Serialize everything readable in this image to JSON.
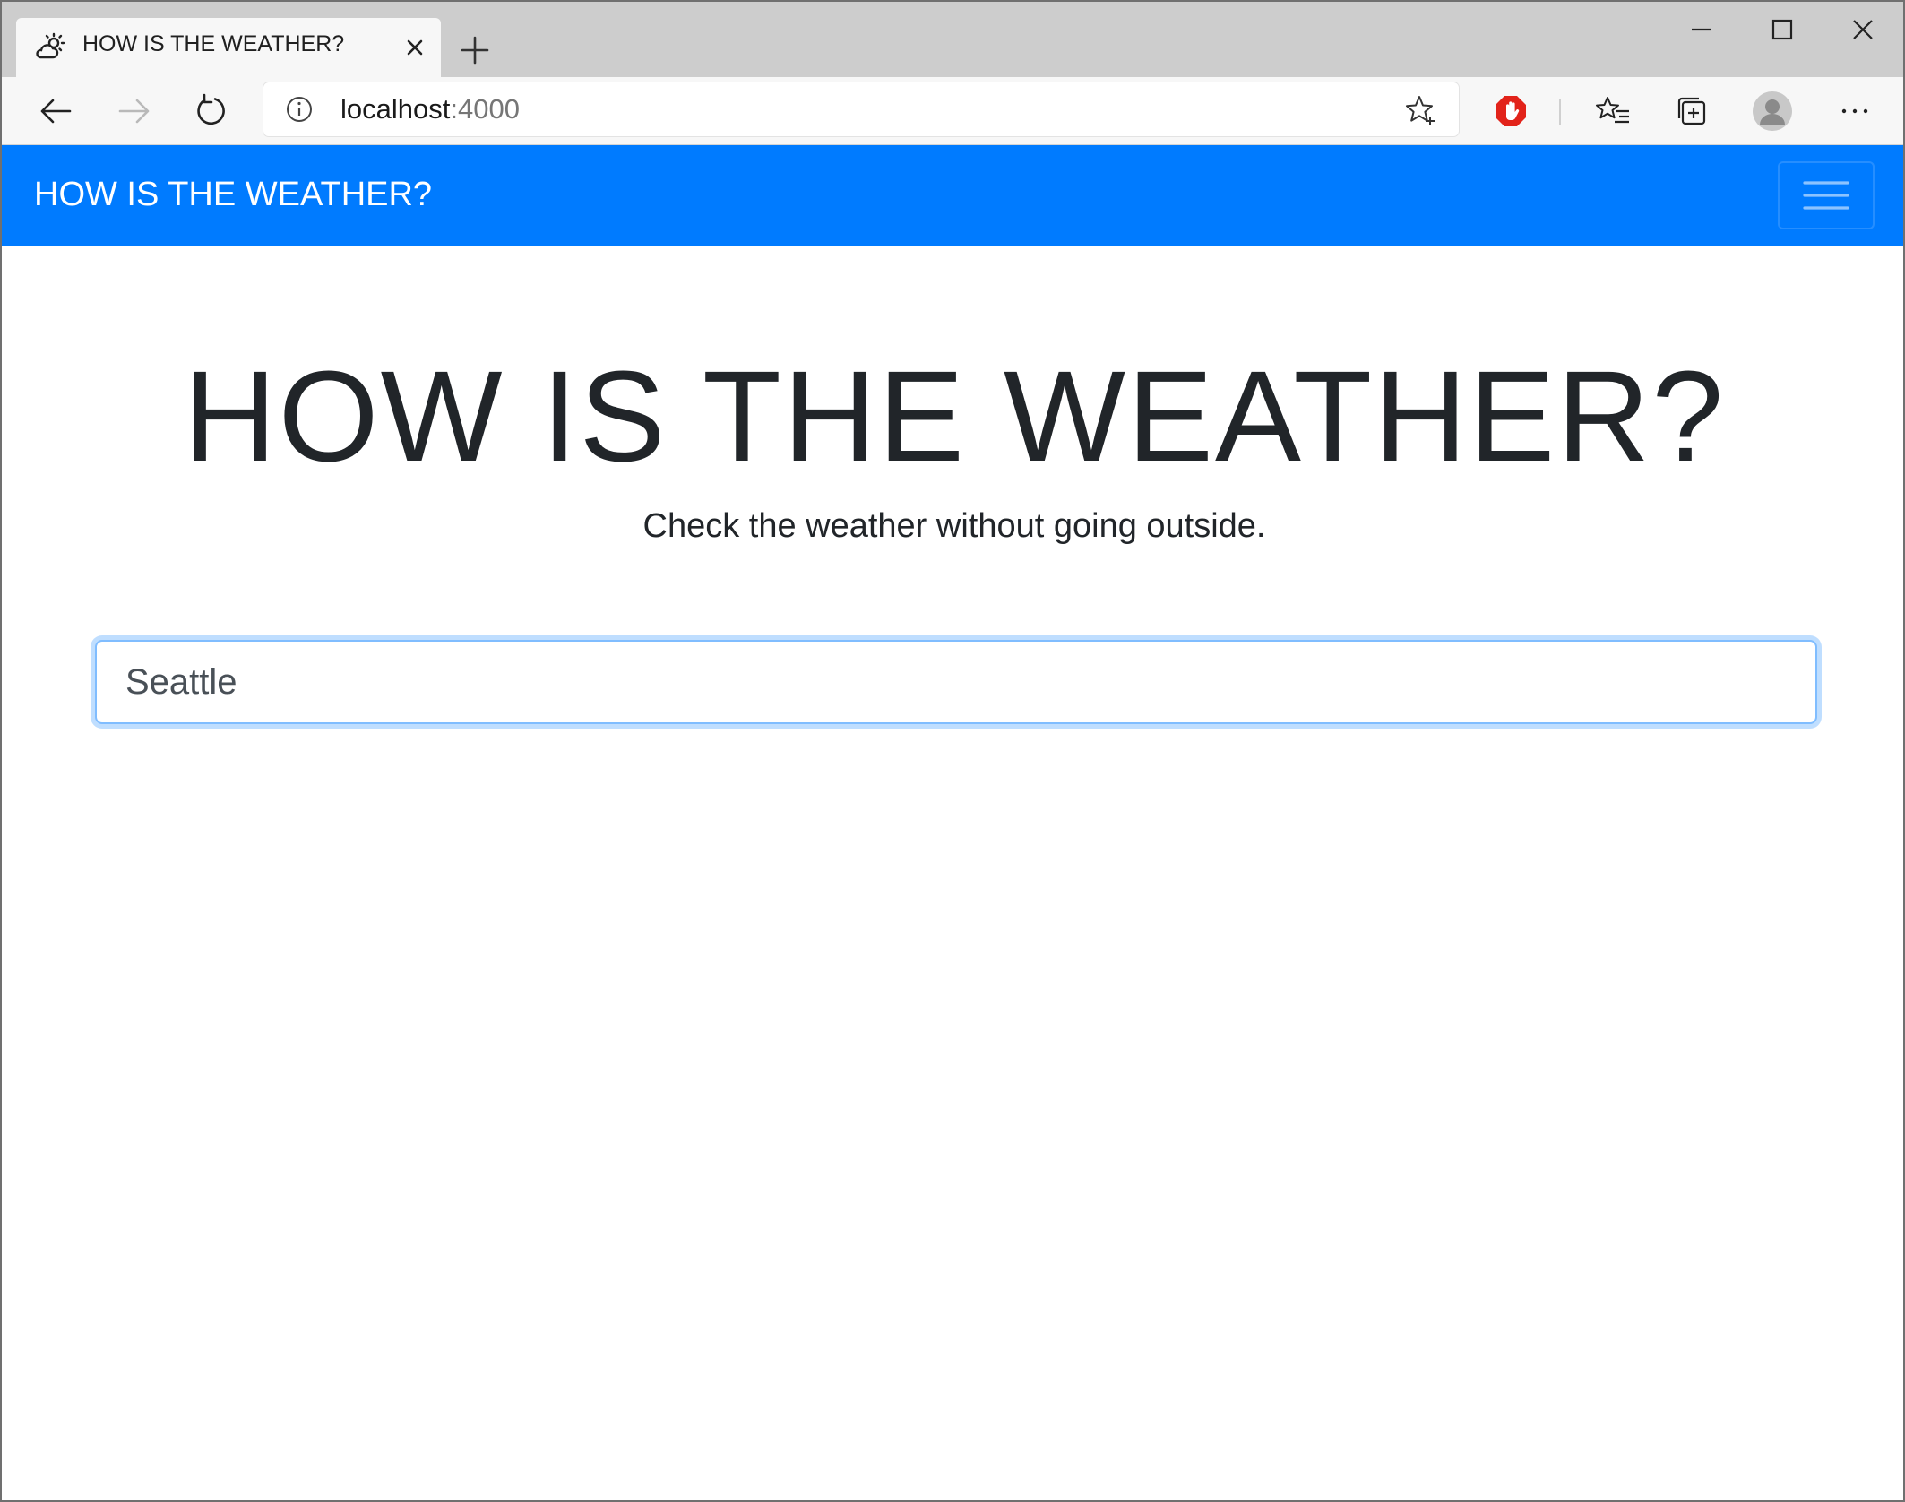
{
  "browser": {
    "tab": {
      "title": "HOW IS THE WEATHER?",
      "favicon": "weather-cloud-sun-icon"
    },
    "address": {
      "host": "localhost",
      "port": ":4000"
    },
    "toolbar_icons": [
      "back-icon",
      "forward-icon",
      "refresh-icon",
      "info-icon",
      "favorite-star-icon",
      "adblock-stop-icon",
      "favorites-list-icon",
      "collections-icon",
      "profile-avatar-icon",
      "more-icon"
    ],
    "window_controls": [
      "minimize-icon",
      "maximize-icon",
      "close-icon"
    ]
  },
  "page": {
    "navbar": {
      "brand": "HOW IS THE WEATHER?",
      "accent_color": "#007bff"
    },
    "hero": {
      "title": "HOW IS THE WEATHER?",
      "subtitle": "Check the weather without going outside."
    },
    "search": {
      "value": "Seattle"
    }
  }
}
